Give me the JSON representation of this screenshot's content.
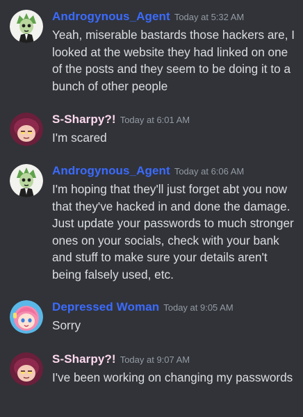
{
  "colors": {
    "background": "#313338",
    "text": "#dbdee1",
    "timestamp": "#949ba4",
    "username_agent": "#3b6bff",
    "username_sharpy": "#ffd9ef",
    "username_depressed": "#3b6bff"
  },
  "messages": [
    {
      "author": "Androgynous_Agent",
      "time": "Today at 5:32 AM",
      "text": "Yeah, miserable bastards those hackers are, I looked at the website they had linked on one of the posts and they seem to be doing it to a bunch of other people",
      "avatar": "androgynous-agent-avatar-icon"
    },
    {
      "author": "S-Sharpy?!",
      "time": "Today at 6:01 AM",
      "text": "I'm scared",
      "avatar": "s-sharpy-avatar-icon"
    },
    {
      "author": "Androgynous_Agent",
      "time": "Today at 6:06 AM",
      "text": "I'm hoping that they'll just forget abt you now that they've hacked in and done the damage. Just update your passwords to much stronger ones on your socials, check with your bank and stuff to make sure your details aren't being falsely used, etc.",
      "avatar": "androgynous-agent-avatar-icon"
    },
    {
      "author": "Depressed Woman",
      "time": "Today at 9:05 AM",
      "text": "Sorry",
      "avatar": "depressed-woman-avatar-icon"
    },
    {
      "author": "S-Sharpy?!",
      "time": "Today at 9:07 AM",
      "text": "I've been working on changing my passwords",
      "avatar": "s-sharpy-avatar-icon"
    }
  ]
}
